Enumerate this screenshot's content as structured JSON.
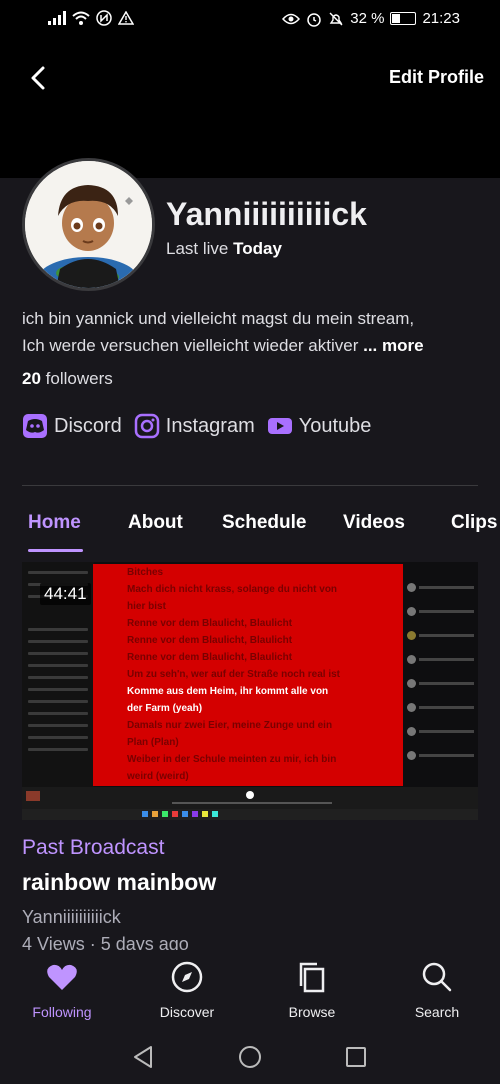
{
  "status_bar": {
    "battery": "32 %",
    "time": "21:23"
  },
  "header": {
    "edit_label": "Edit Profile"
  },
  "profile": {
    "username": "Yanniiiiiiiiiick",
    "last_live_prefix": "Last live",
    "last_live_value": "Today",
    "bio_line1": "ich bin yannick und vielleicht magst du mein stream,",
    "bio_line2": "Ich werde versuchen vielleicht wieder aktiver",
    "bio_more": "... more",
    "followers_count": "20",
    "followers_label": "followers"
  },
  "socials": [
    {
      "label": "Discord",
      "icon": "discord-icon"
    },
    {
      "label": "Instagram",
      "icon": "instagram-icon"
    },
    {
      "label": "Youtube",
      "icon": "youtube-icon"
    }
  ],
  "tabs": [
    {
      "label": "Home",
      "active": true
    },
    {
      "label": "About"
    },
    {
      "label": "Schedule"
    },
    {
      "label": "Videos"
    },
    {
      "label": "Clips"
    }
  ],
  "video": {
    "duration": "44:41",
    "category": "Past Broadcast",
    "title": "rainbow mainbow",
    "channel": "Yanniiiiiiiiiick",
    "meta": "4 Views · 5 days ago",
    "lyrics": [
      "Bitches",
      "Mach dich nicht krass, solange du nicht von",
      "hier bist",
      "Renne vor dem Blaulicht, Blaulicht",
      "Renne vor dem Blaulicht, Blaulicht",
      "Renne vor dem Blaulicht, Blaulicht",
      "Um zu seh'n, wer auf der Straße noch real ist",
      "Komme aus dem Heim, ihr kommt alle von",
      "der Farm (yeah)",
      "Damals nur zwei Eier, meine Zunge und ein",
      "Plan (Plan)",
      "Weiber in der Schule meinten zu mir, ich bin",
      "weird (weird)"
    ]
  },
  "bottom_nav": [
    {
      "label": "Following",
      "icon": "heart-icon",
      "active": true
    },
    {
      "label": "Discover",
      "icon": "compass-icon"
    },
    {
      "label": "Browse",
      "icon": "browse-icon"
    },
    {
      "label": "Search",
      "icon": "search-icon"
    }
  ],
  "colors": {
    "accent": "#bf94ff",
    "background": "#18171c",
    "thumbnail_red": "#d40000"
  }
}
